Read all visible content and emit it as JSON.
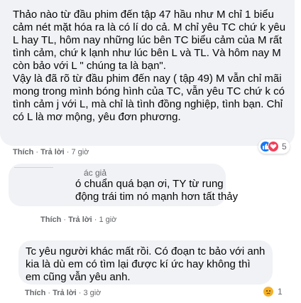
{
  "comments": [
    {
      "text": "Thảo nào từ đầu phim đến tập 47 hầu như M chỉ 1 biểu cảm nét mặt hóa ra là có lí do cả. M chỉ yêu TC chứ k yêu L hay TL, hôm nay những lúc bên TC biểu cảm của M rất tình cảm, chứ k lạnh như lúc bên L và TL. Và hôm nay M còn bảo với L \" chúng ta là bạn\".\nVậy là đã rõ từ đầu phim đến nay ( tập 49) M vẫn chỉ mãi mong trong mình bóng hình của TC, vẫn yêu TC chứ k có tình cảm j với L, mà chỉ là tình đồng nghiệp, tình bạn. Chỉ có L là mơ mộng, yêu đơn phương.",
      "like_label": "Thích",
      "reply_label": "Trả lời",
      "time": "7 giờ",
      "reaction_count": "5",
      "reactions": [
        "like-icon",
        "love-icon"
      ]
    },
    {
      "author": "ác giả",
      "text": "ó chuẩn quá bạn ơi, TY từ rung động trái tim nó mạnh hơn tất thảy",
      "like_label": "Thích",
      "reply_label": "Trả lời",
      "time": "1 giờ"
    },
    {
      "text": "Tc yêu người khác mất rồi. Có đoạn tc bảo với anh kia là dù em có tìm lại được kí ức hay không thì em cũng vẫn yêu anh.",
      "like_label": "Thích",
      "reply_label": "Trả lời",
      "time": "3 giờ",
      "reaction_count": "1",
      "reactions": [
        "sad-icon"
      ]
    }
  ],
  "colors": {
    "bubble": "#f0f2f5",
    "meta": "#65676b",
    "like": "#1877f2",
    "love": "#f33e58",
    "sad": "#f7b125"
  }
}
